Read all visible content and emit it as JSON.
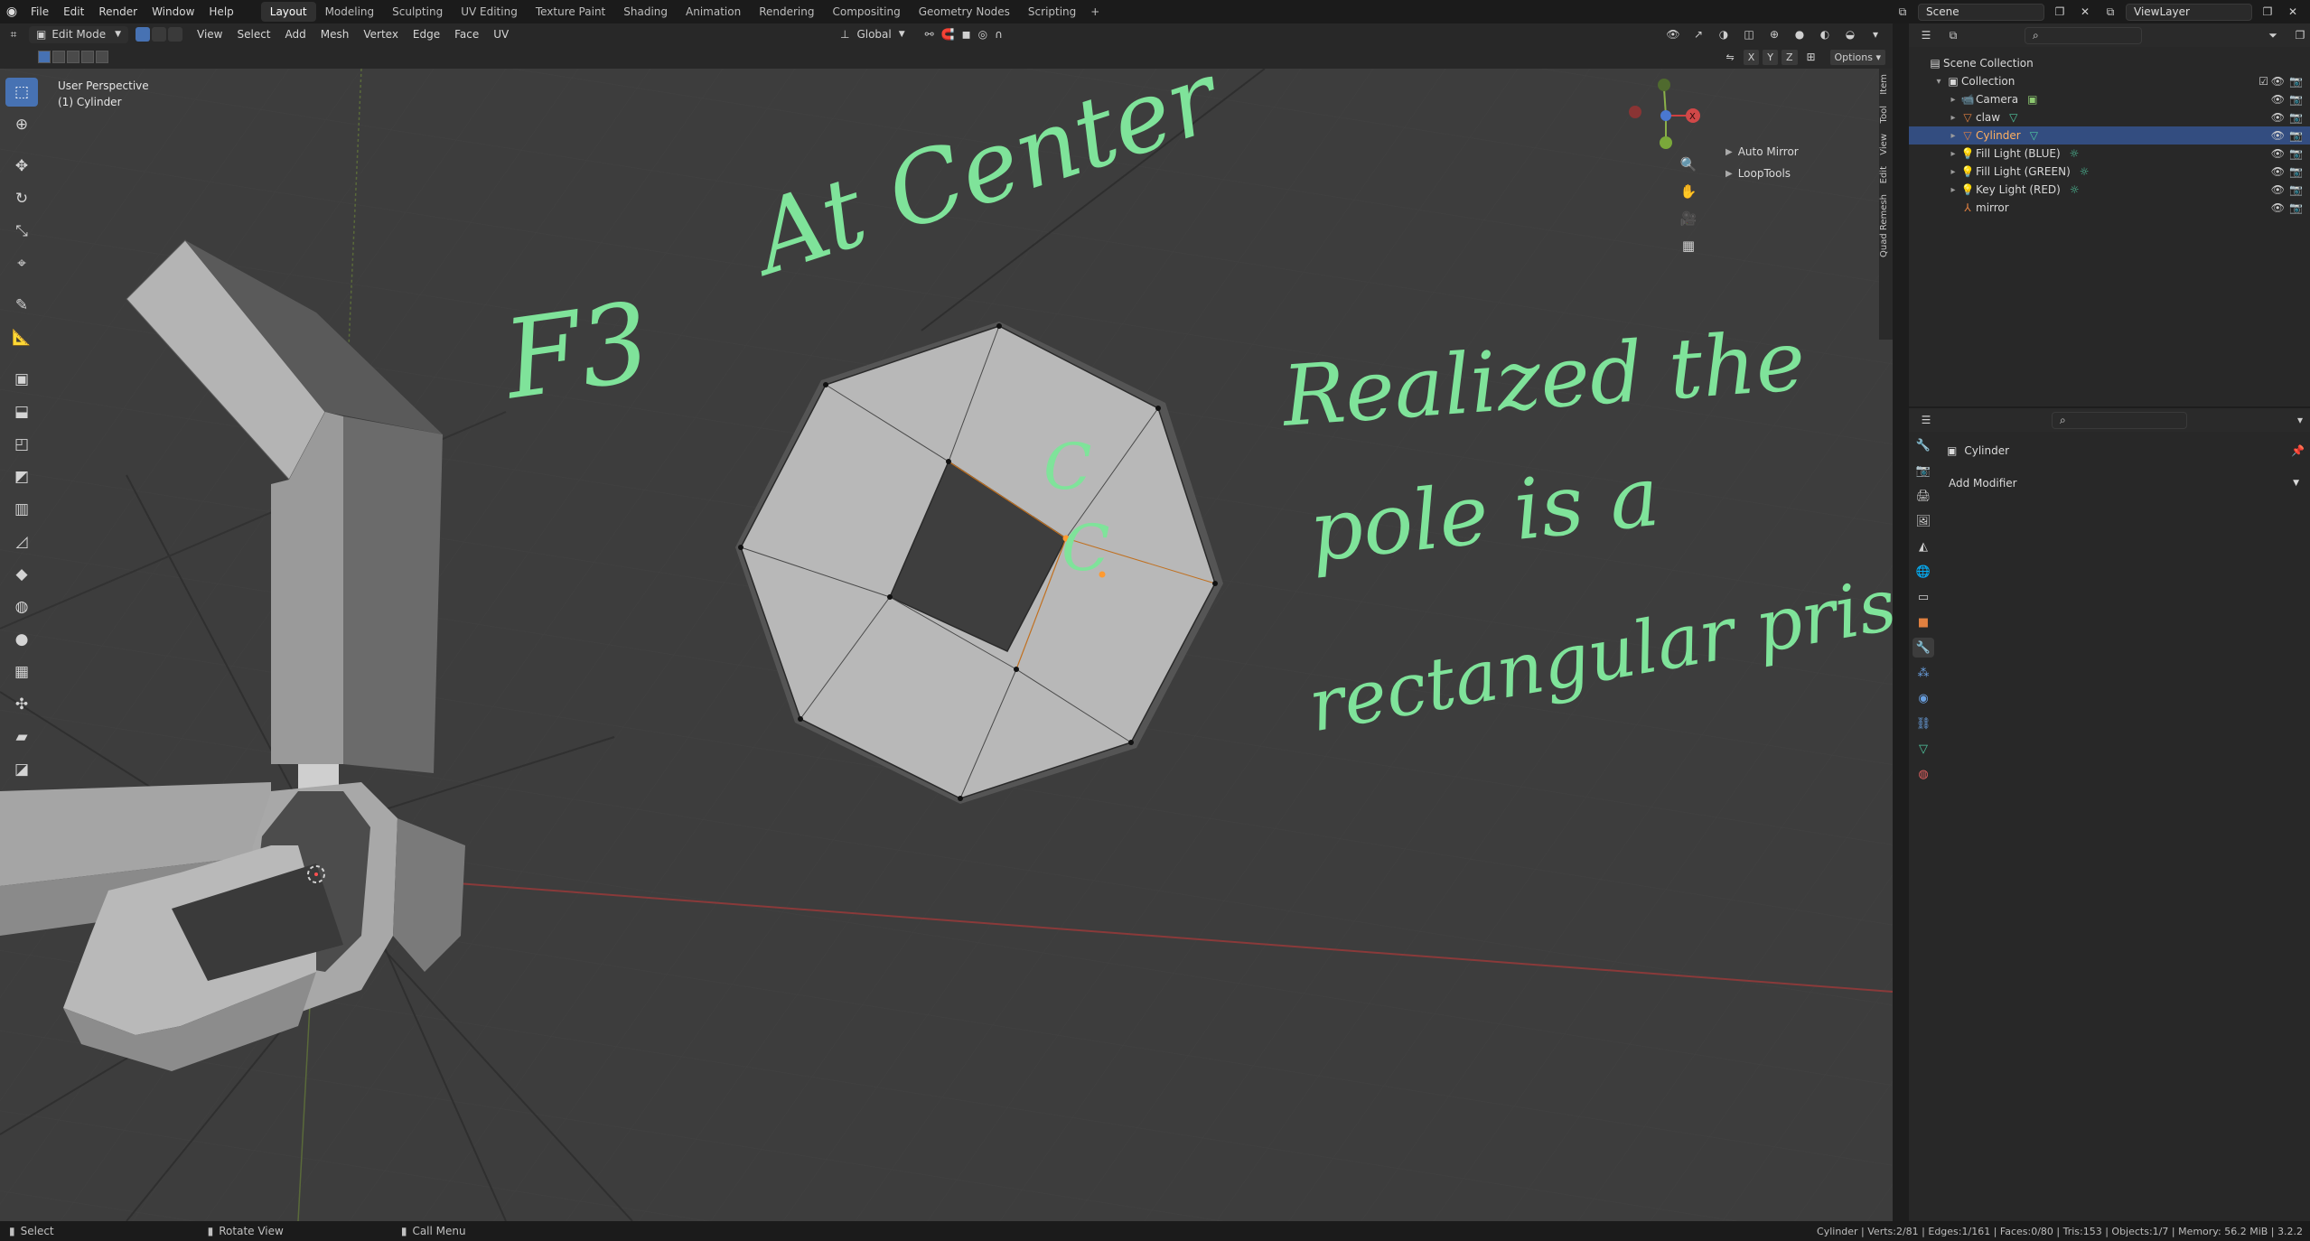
{
  "topbar": {
    "menus": [
      "File",
      "Edit",
      "Render",
      "Window",
      "Help"
    ],
    "workspaces": [
      "Layout",
      "Modeling",
      "Sculpting",
      "UV Editing",
      "Texture Paint",
      "Shading",
      "Animation",
      "Rendering",
      "Compositing",
      "Geometry Nodes",
      "Scripting"
    ],
    "active_workspace": "Layout",
    "scene": "Scene",
    "view_layer": "ViewLayer"
  },
  "viewport_header": {
    "mode": "Edit Mode",
    "menus": [
      "View",
      "Select",
      "Add",
      "Mesh",
      "Vertex",
      "Edge",
      "Face",
      "UV"
    ],
    "orientation": "Global",
    "options_label": "Options",
    "axes": [
      "X",
      "Y",
      "Z"
    ]
  },
  "viewport": {
    "perspective": "User Perspective",
    "object_label": "(1) Cylinder",
    "npanel_items": [
      "Auto Mirror",
      "LoopTools"
    ],
    "side_tabs": [
      "Item",
      "Tool",
      "View",
      "Edit",
      "Quad Remesh"
    ]
  },
  "annotations": {
    "f3": "F3",
    "at_center": "At Center",
    "realized": "Realized the",
    "pole": "pole is a",
    "rect": "rectangular prism",
    "cc1": "C",
    "cc2": "C"
  },
  "outliner": {
    "root": "Scene Collection",
    "collection": "Collection",
    "items": [
      {
        "name": "Camera",
        "icon": "camera-icon",
        "color": "#e08040"
      },
      {
        "name": "claw",
        "icon": "mesh-icon",
        "color": "#e08040"
      },
      {
        "name": "Cylinder",
        "icon": "mesh-icon",
        "color": "#e08040",
        "selected": true
      },
      {
        "name": "Fill Light (BLUE)",
        "icon": "light-icon",
        "color": "#e08040"
      },
      {
        "name": "Fill Light (GREEN)",
        "icon": "light-icon",
        "color": "#e08040"
      },
      {
        "name": "Key Light (RED)",
        "icon": "light-icon",
        "color": "#e08040"
      },
      {
        "name": "mirror",
        "icon": "empty-icon",
        "color": "#e08040"
      }
    ]
  },
  "properties": {
    "object_name": "Cylinder",
    "add_modifier": "Add Modifier"
  },
  "statusbar": {
    "select": "Select",
    "rotate": "Rotate View",
    "menu": "Call Menu",
    "stats": "Cylinder | Verts:2/81 | Edges:1/161 | Faces:0/80 | Tris:153 | Objects:1/7 | Memory: 56.2 MiB | 3.2.2"
  },
  "colors": {
    "accent": "#4772b3",
    "annotation": "#7fe39a",
    "object_orange": "#e08040"
  }
}
